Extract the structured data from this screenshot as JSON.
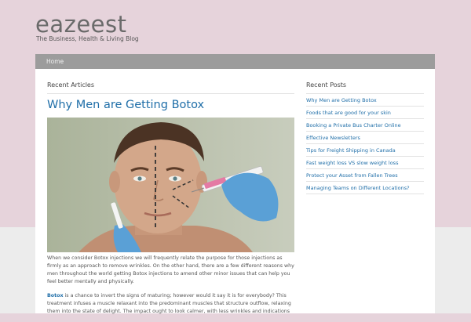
{
  "site": {
    "title": "eazeest",
    "description": "The Business, Health & Living Blog"
  },
  "nav": {
    "home": "Home"
  },
  "main": {
    "section_label": "Recent Articles",
    "post_title": "Why Men are Getting Botox",
    "paragraph1": "When we consider Botox injections we will frequently relate the purpose for those injections as firmly as an approach to remove wrinkles. On the other hand, there are a few different reasons why men throughout the world getting Botox injections to amend other minor issues that can help you feel better mentally and physically.",
    "paragraph2_link": "Botox",
    "paragraph2_rest": " is a chance to invert the signs of maturing; however would it say it is for everybody? This treatment infuses a muscle relaxant into the predominant muscles that structure outflow, relaxing them into the state of delight. The impact ought to look calmer, with less wrinkles and indications"
  },
  "sidebar": {
    "title": "Recent Posts",
    "items": [
      "Why Men are Getting Botox",
      "Foods that are good for your skin",
      "Booking a Private Bus Charter Online",
      "Effective Newsletters",
      "Tips for Freight Shipping in Canada",
      "Fast weight loss VS slow weight loss",
      "Protect your Asset from Fallen Trees",
      "Managing Teams on Different Locations?"
    ]
  },
  "colors": {
    "background": "#e6d3db",
    "link": "#1f6ea8",
    "nav": "#9c9c9c"
  }
}
